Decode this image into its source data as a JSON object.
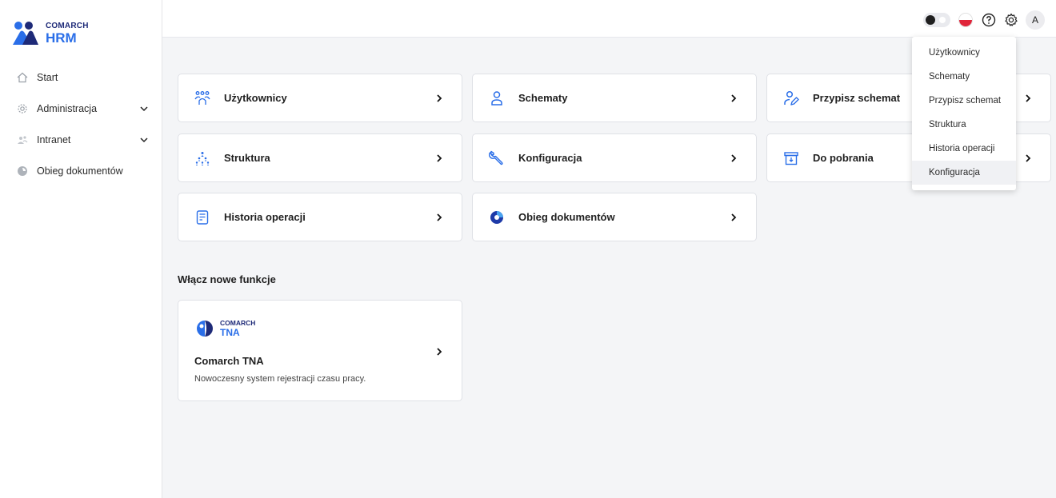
{
  "logo": {
    "brand": "COMARCH",
    "product": "HRM"
  },
  "sidebar": {
    "items": [
      {
        "label": "Start",
        "icon": "home-icon"
      },
      {
        "label": "Administracja",
        "icon": "gear-icon",
        "expandable": true
      },
      {
        "label": "Intranet",
        "icon": "people-icon",
        "expandable": true
      },
      {
        "label": "Obieg dokumentów",
        "icon": "document-flow-icon"
      }
    ]
  },
  "topbar": {
    "theme_toggle": "dark-mode-toggle",
    "language": "pl",
    "avatar_initial": "A"
  },
  "tiles": [
    {
      "label": "Użytkownicy",
      "icon": "users-group-icon"
    },
    {
      "label": "Schematy",
      "icon": "person-icon"
    },
    {
      "label": "Przypisz schemat",
      "icon": "assign-user-icon"
    },
    {
      "label": "Struktura",
      "icon": "org-structure-icon"
    },
    {
      "label": "Konfiguracja",
      "icon": "wrench-icon"
    },
    {
      "label": "Do pobrania",
      "icon": "download-box-icon"
    },
    {
      "label": "Historia operacji",
      "icon": "history-list-icon"
    },
    {
      "label": "Obieg dokumentów",
      "icon": "document-flow-icon"
    }
  ],
  "features": {
    "title": "Włącz nowe funkcje",
    "card": {
      "brand": "COMARCH",
      "product": "TNA",
      "name": "Comarch TNA",
      "description": "Nowoczesny system rejestracji czasu pracy."
    }
  },
  "settings_menu": {
    "items": [
      "Użytkownicy",
      "Schematy",
      "Przypisz schemat",
      "Struktura",
      "Historia operacji",
      "Konfiguracja"
    ],
    "highlighted": "Konfiguracja"
  },
  "colors": {
    "brand_dark": "#1e2a78",
    "brand_blue": "#2a6ee8",
    "background": "#f4f5f7"
  }
}
